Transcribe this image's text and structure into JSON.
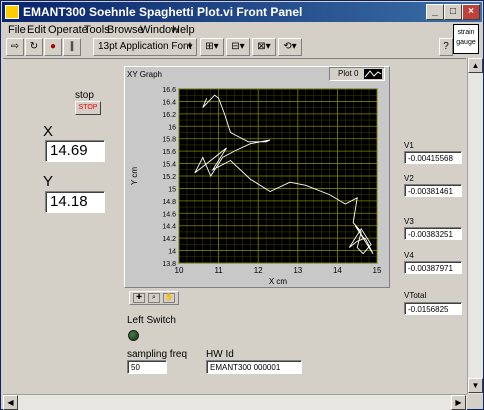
{
  "window": {
    "title": "EMANT300 Soehnle Spaghetti Plot.vi Front Panel"
  },
  "menu": [
    "File",
    "Edit",
    "Operate",
    "Tools",
    "Browse",
    "Window",
    "Help"
  ],
  "toolbar": {
    "font_label": "13pt Application Font"
  },
  "gauge_icon": {
    "label": "strain gauge"
  },
  "stop": {
    "label": "stop",
    "button": "STOP"
  },
  "x_readout": {
    "label": "X",
    "value": "14.69"
  },
  "y_readout": {
    "label": "Y",
    "value": "14.18"
  },
  "graph": {
    "title": "XY Graph",
    "legend": "Plot 0"
  },
  "v1": {
    "label": "V1",
    "value": "-0.00415568"
  },
  "v2": {
    "label": "V2",
    "value": "-0.00381461"
  },
  "v3": {
    "label": "V3",
    "value": "-0.00383251"
  },
  "v4": {
    "label": "V4",
    "value": "-0.00387971"
  },
  "vtotal": {
    "label": "VTotal",
    "value": "-0.0156825"
  },
  "left_switch": {
    "label": "Left Switch"
  },
  "sampling": {
    "label": "sampling freq",
    "value": "50"
  },
  "hwid": {
    "label": "HW Id",
    "value": "EMANT300 000001"
  },
  "chart_data": {
    "type": "line",
    "title": "XY Graph",
    "xlabel": "X cm",
    "ylabel": "Y cm",
    "xlim": [
      10,
      15
    ],
    "ylim": [
      13.8,
      16.6
    ],
    "grid": true,
    "x_ticks": [
      "10",
      "11",
      "12",
      "13",
      "14",
      "15"
    ],
    "y_ticks": [
      "13.8",
      "14",
      "14.2",
      "14.4",
      "14.6",
      "14.8",
      "15",
      "15.2",
      "15.4",
      "15.6",
      "15.8",
      "16",
      "16.2",
      "16.4",
      "16.6"
    ],
    "background": "#000000",
    "grid_color": "#808000",
    "line_color": "#ffffff",
    "series": [
      {
        "name": "Plot 0",
        "x": [
          10.7,
          10.6,
          10.9,
          11.0,
          11.15,
          11.3,
          11.45,
          11.75,
          12.2,
          12.3,
          11.8,
          11.4,
          11.1,
          10.8,
          10.6,
          10.4,
          10.8,
          11.2,
          11.0,
          10.85,
          11.3,
          11.8,
          12.3,
          12.8,
          13.2,
          13.8,
          14.2,
          14.5,
          14.4,
          14.6,
          14.5,
          14.65,
          14.85,
          14.6,
          14.3,
          14.5,
          14.7,
          14.9,
          14.6,
          14.45,
          14.69
        ],
        "y": [
          16.45,
          16.3,
          16.5,
          16.45,
          16.2,
          15.9,
          15.85,
          15.75,
          15.75,
          15.78,
          15.72,
          15.6,
          15.5,
          15.2,
          15.5,
          15.25,
          15.45,
          15.65,
          15.45,
          15.3,
          15.45,
          15.15,
          14.95,
          15.1,
          15.05,
          14.9,
          14.75,
          14.85,
          14.45,
          14.3,
          14.05,
          13.95,
          14.1,
          14.35,
          14.05,
          14.15,
          14.2,
          13.95,
          14.25,
          14.4,
          14.18
        ]
      }
    ]
  }
}
